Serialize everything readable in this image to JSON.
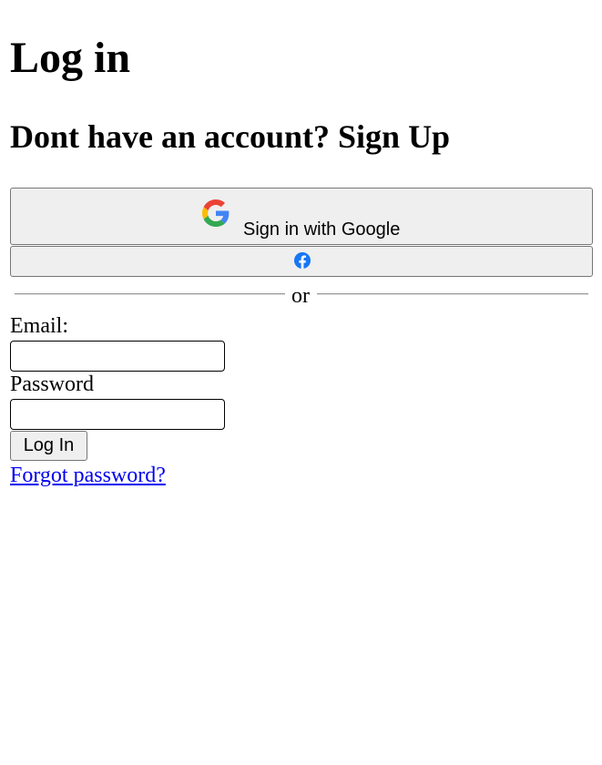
{
  "page": {
    "title": "Log in",
    "subtitle": "Dont have an account? Sign Up"
  },
  "social": {
    "google_label": "Sign in with Google",
    "google_icon": "google-g-logo-icon",
    "facebook_icon": "facebook-logo-icon"
  },
  "divider": {
    "text": "or"
  },
  "form": {
    "email_label": "Email:",
    "email_value": "",
    "password_label": "Password",
    "password_value": "",
    "submit_label": "Log In",
    "forgot_label": "Forgot password?"
  },
  "colors": {
    "button_bg": "#efefef",
    "link": "#0000ee",
    "facebook_blue": "#1877f2",
    "google_blue": "#4285f4",
    "google_red": "#ea4335",
    "google_yellow": "#fbbc05",
    "google_green": "#34a853"
  }
}
